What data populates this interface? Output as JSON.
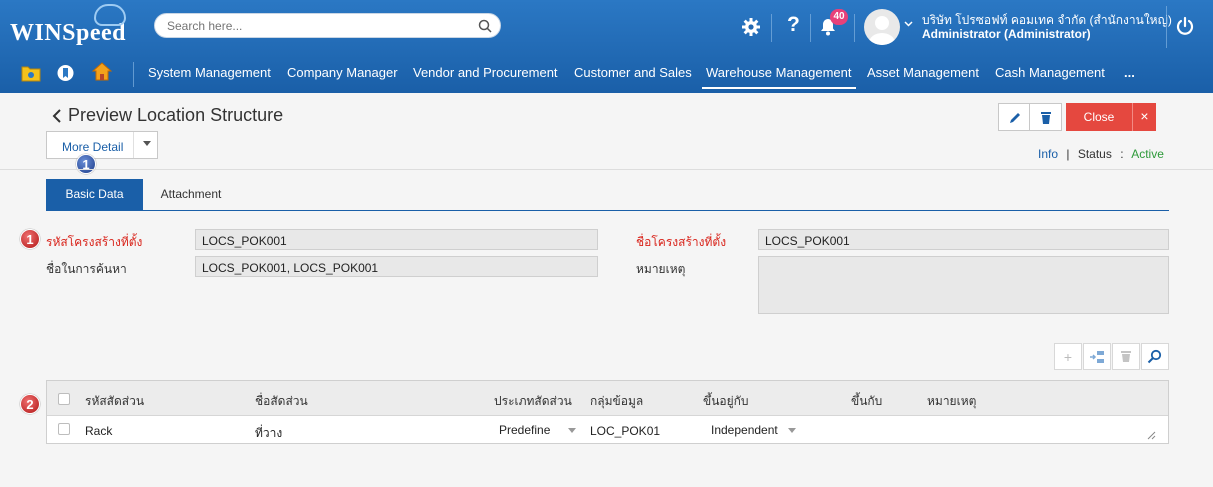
{
  "brand": {
    "logo_text": "WINSpeed"
  },
  "search": {
    "placeholder": "Search here..."
  },
  "notifications": {
    "count": "40"
  },
  "user": {
    "company": "บริษัท โปรซอฟท์ คอมเทค จำกัด (สำนักงานใหญ่)",
    "role": "Administrator (Administrator)"
  },
  "menu": {
    "items": [
      "System Management",
      "Company Manager",
      "Vendor and Procurement",
      "Customer and Sales",
      "Warehouse Management",
      "Asset Management",
      "Cash Management",
      "..."
    ],
    "active": "Warehouse Management"
  },
  "page": {
    "title": "Preview Location Structure",
    "more_detail": "More Detail",
    "close_label": "Close",
    "close_x": "×",
    "info_label": "Info",
    "info_sep": "|",
    "status_label": "Status",
    "status_colon": ":",
    "status_value": "Active"
  },
  "tabs": {
    "basic": "Basic Data",
    "attachment": "Attachment"
  },
  "markers": {
    "m1": "1",
    "m2": "2"
  },
  "form": {
    "code_label": "รหัสโครงสร้างที่ตั้ง",
    "code_value": "LOCS_POK001",
    "name_label": "ชื่อโครงสร้างที่ตั้ง",
    "name_value": "LOCS_POK001",
    "search_label": "ชื่อในการค้นหา",
    "search_value": "LOCS_POK001, LOCS_POK001",
    "remark_label": "หมายเหตุ",
    "remark_value": ""
  },
  "grid": {
    "columns": [
      "รหัสสัดส่วน",
      "ชื่อสัดส่วน",
      "ประเภทสัดส่วน",
      "กลุ่มข้อมูล",
      "ขึ้นอยู่กับ",
      "ขึ้นกับ",
      "หมายเหตุ"
    ],
    "rows": [
      {
        "code": "Rack",
        "name": "ที่วาง",
        "type": "Predefine",
        "group": "LOC_POK01",
        "depends": "Independent",
        "parent": "",
        "remark": ""
      }
    ]
  },
  "colors": {
    "primary": "#1a5fa8",
    "danger": "#e5483f",
    "required": "#d9251c",
    "active_status": "#2e9a3a"
  }
}
